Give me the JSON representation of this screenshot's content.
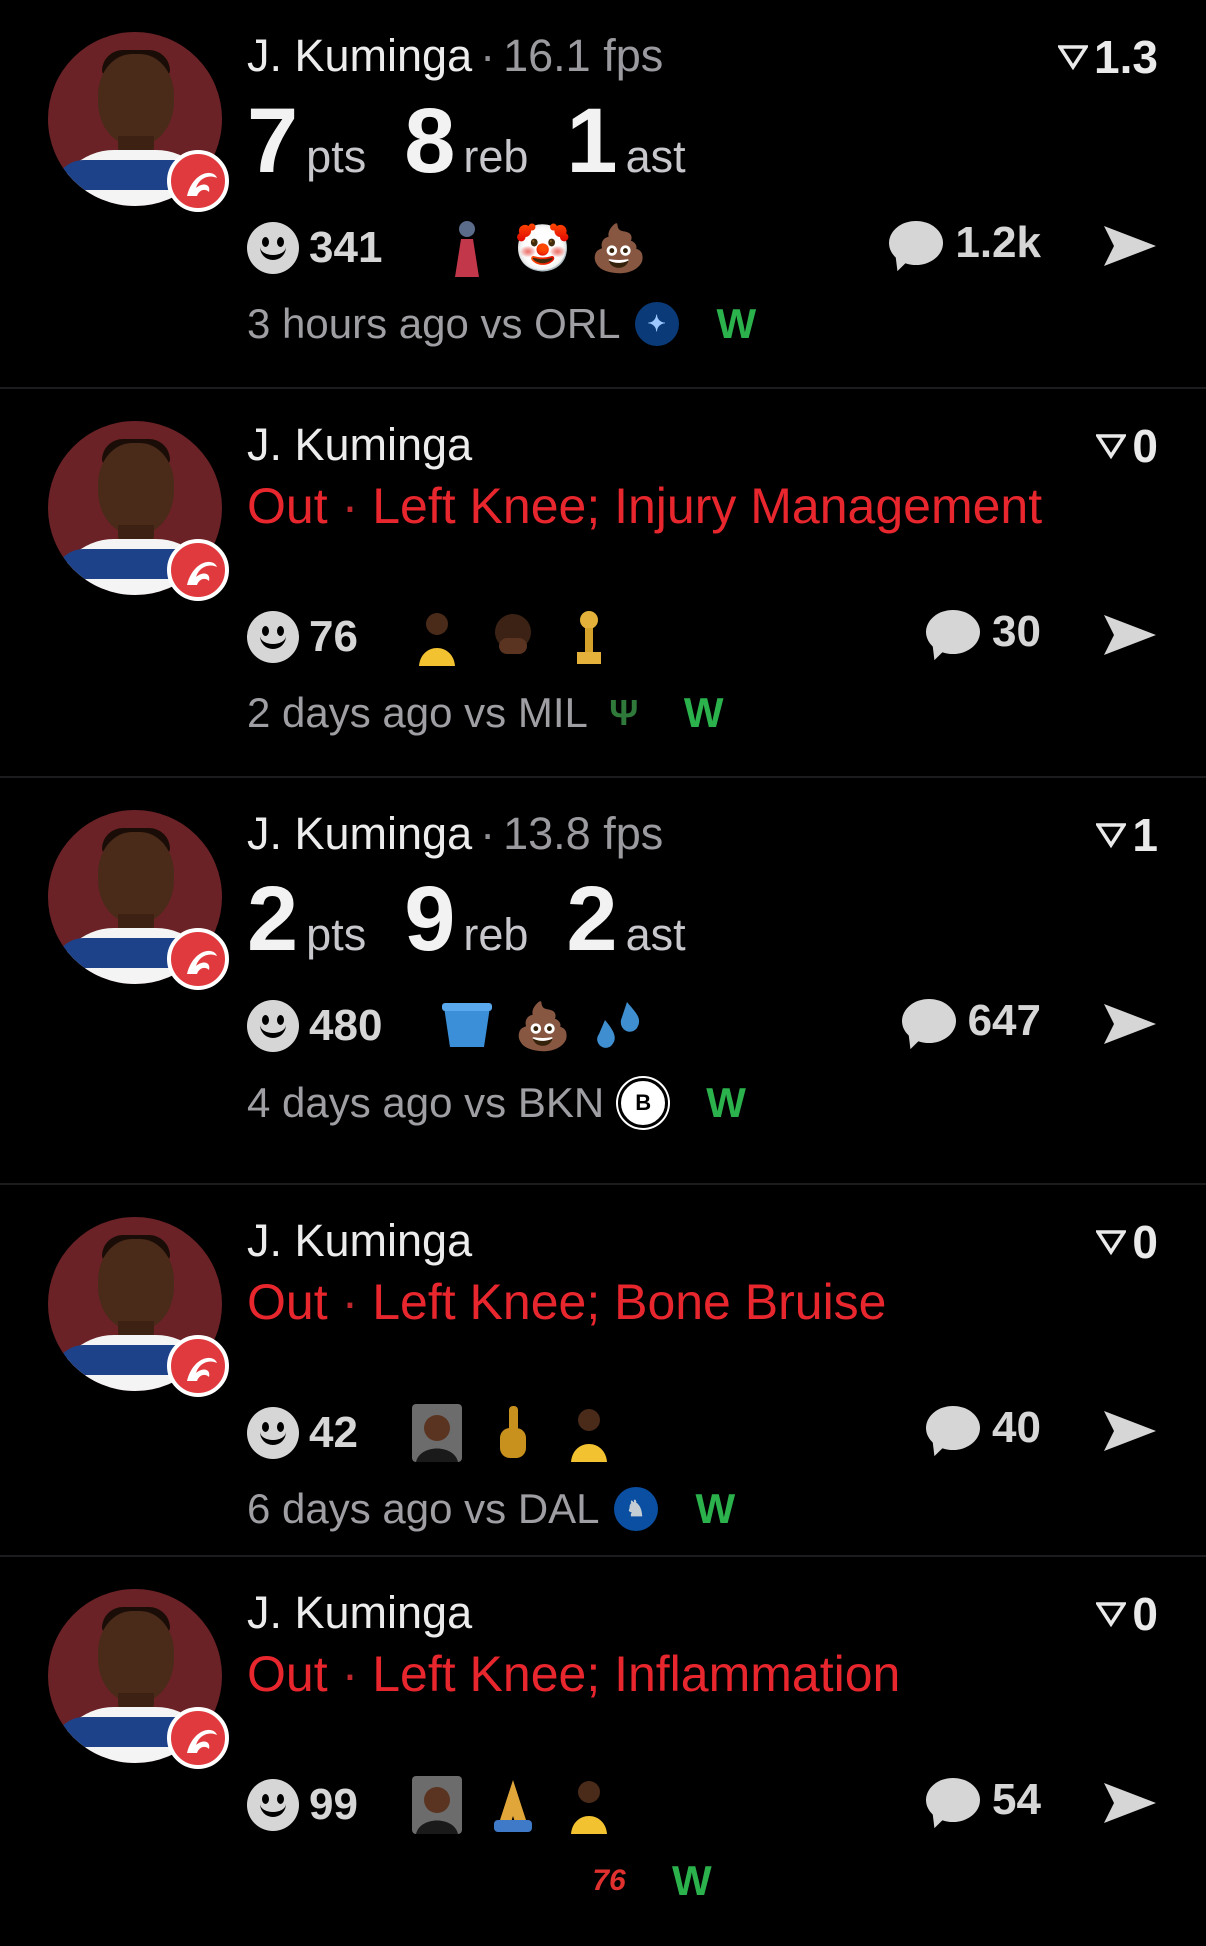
{
  "colors": {
    "background": "#000000",
    "injury_red": "#e8262d",
    "win_green": "#2bb24c",
    "muted": "#9e9ea3",
    "accent_team": "#e03a3e"
  },
  "cards": [
    {
      "player": "J. Kuminga",
      "fps": "16.1 fps",
      "vote": "1.3",
      "stats": [
        {
          "num": "7",
          "label": "pts"
        },
        {
          "num": "8",
          "label": "reb"
        },
        {
          "num": "1",
          "label": "ast"
        }
      ],
      "reactions": "341",
      "emojis": [
        "person-icon",
        "clown-face-icon",
        "pile-of-poo-icon"
      ],
      "comments": "1.2k",
      "time": "3 hours ago vs ORL",
      "team": "orlando-magic-logo",
      "result": "W"
    },
    {
      "player": "J. Kuminga",
      "status": "Out",
      "injury": "Left Knee; Injury Management",
      "vote": "0",
      "reactions": "76",
      "emojis": [
        "player-photo-icon",
        "face-palm-icon",
        "trophy-icon"
      ],
      "comments": "30",
      "time": "2 days ago vs MIL",
      "team": "milwaukee-bucks-logo",
      "result": "W"
    },
    {
      "player": "J. Kuminga",
      "fps": "13.8 fps",
      "vote": "1",
      "stats": [
        {
          "num": "2",
          "label": "pts"
        },
        {
          "num": "9",
          "label": "reb"
        },
        {
          "num": "2",
          "label": "ast"
        }
      ],
      "reactions": "480",
      "emojis": [
        "bucket-icon",
        "pile-of-poo-icon",
        "sweat-droplets-icon"
      ],
      "comments": "647",
      "time": "4 days ago vs BKN",
      "team": "brooklyn-nets-logo",
      "result": "W"
    },
    {
      "player": "J. Kuminga",
      "status": "Out",
      "injury": "Left Knee; Bone Bruise",
      "vote": "0",
      "reactions": "42",
      "emojis": [
        "shocked-person-icon",
        "middle-finger-icon",
        "player-photo-icon"
      ],
      "comments": "40",
      "time": "6 days ago vs DAL",
      "team": "dallas-mavericks-logo",
      "result": "W"
    },
    {
      "player": "J. Kuminga",
      "status": "Out",
      "injury": "Left Knee; Inflammation",
      "vote": "0",
      "reactions": "99",
      "emojis": [
        "shocked-person-icon",
        "folded-hands-icon",
        "player-photo-icon"
      ],
      "comments": "54",
      "time": "",
      "team": "philadelphia-76ers-logo",
      "team_text": "76",
      "result": "W"
    }
  ]
}
